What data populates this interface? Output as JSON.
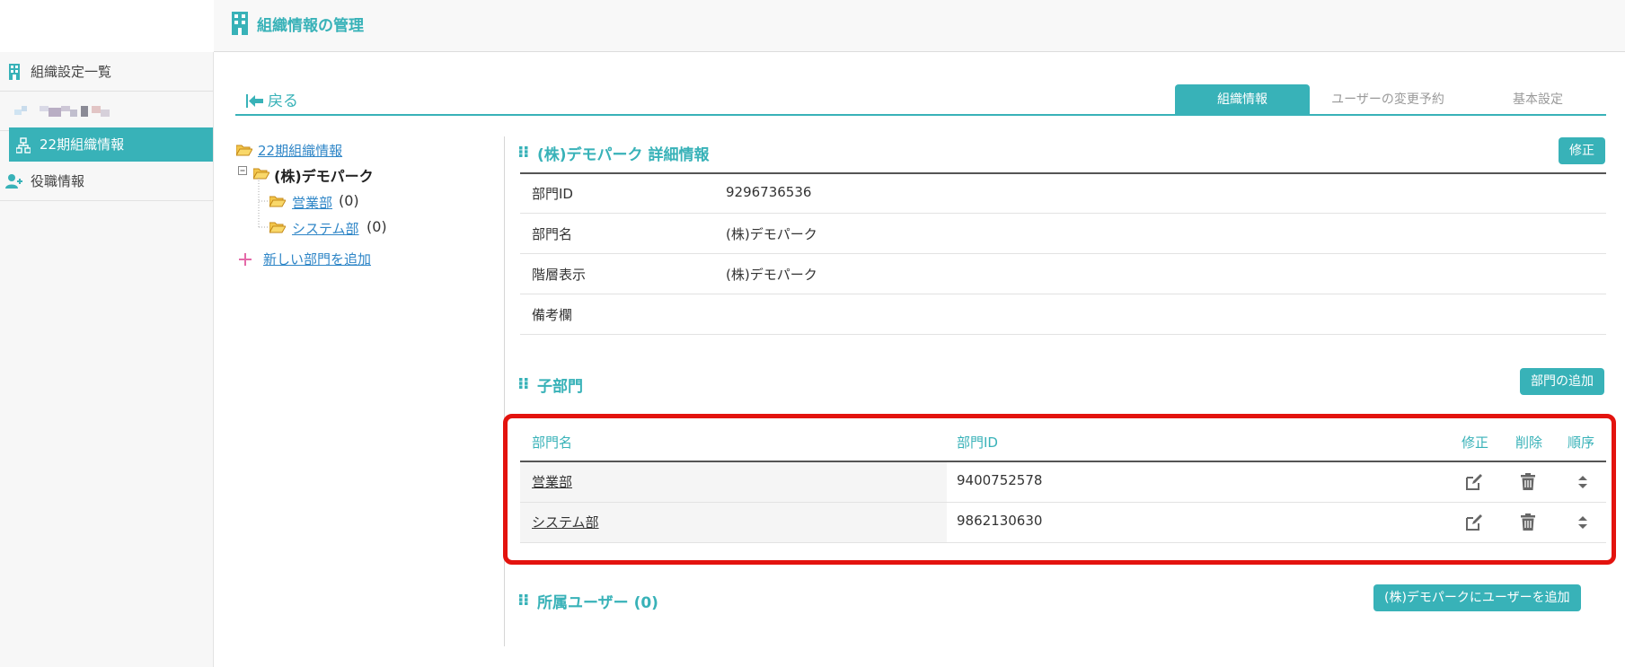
{
  "header": {
    "title": "組織情報の管理"
  },
  "sidebar": {
    "items": [
      {
        "label": "組織設定一覧"
      },
      {
        "label": "22期組織情報"
      },
      {
        "label": "役職情報"
      }
    ]
  },
  "tabs": {
    "back_label": "戻る",
    "items": [
      {
        "label": "組織情報"
      },
      {
        "label": "ユーザーの変更予約"
      },
      {
        "label": "基本設定"
      }
    ]
  },
  "tree": {
    "root": "22期組織情報",
    "company": "(株)デモパーク",
    "children": [
      {
        "label": "営業部",
        "count": "(0)"
      },
      {
        "label": "システム部",
        "count": "(0)"
      }
    ],
    "add_label": "新しい部門を追加"
  },
  "detail": {
    "title": "(株)デモパーク 詳細情報",
    "edit_label": "修正",
    "rows": [
      {
        "key": "部門ID",
        "value": "9296736536"
      },
      {
        "key": "部門名",
        "value": "(株)デモパーク"
      },
      {
        "key": "階層表示",
        "value": "(株)デモパーク"
      },
      {
        "key": "備考欄",
        "value": ""
      }
    ]
  },
  "children_section": {
    "title": "子部門",
    "add_label": "部門の追加",
    "headers": {
      "name": "部門名",
      "id": "部門ID",
      "edit": "修正",
      "delete": "削除",
      "order": "順序"
    },
    "rows": [
      {
        "name": "営業部",
        "id": "9400752578"
      },
      {
        "name": "システム部",
        "id": "9862130630"
      }
    ]
  },
  "users_section": {
    "title": "所属ユーザー (0)",
    "add_label": "(株)デモパークにユーザーを追加"
  },
  "colors": {
    "accent": "#38b2b8",
    "highlight": "#e3130e",
    "link": "#2f86c7"
  }
}
